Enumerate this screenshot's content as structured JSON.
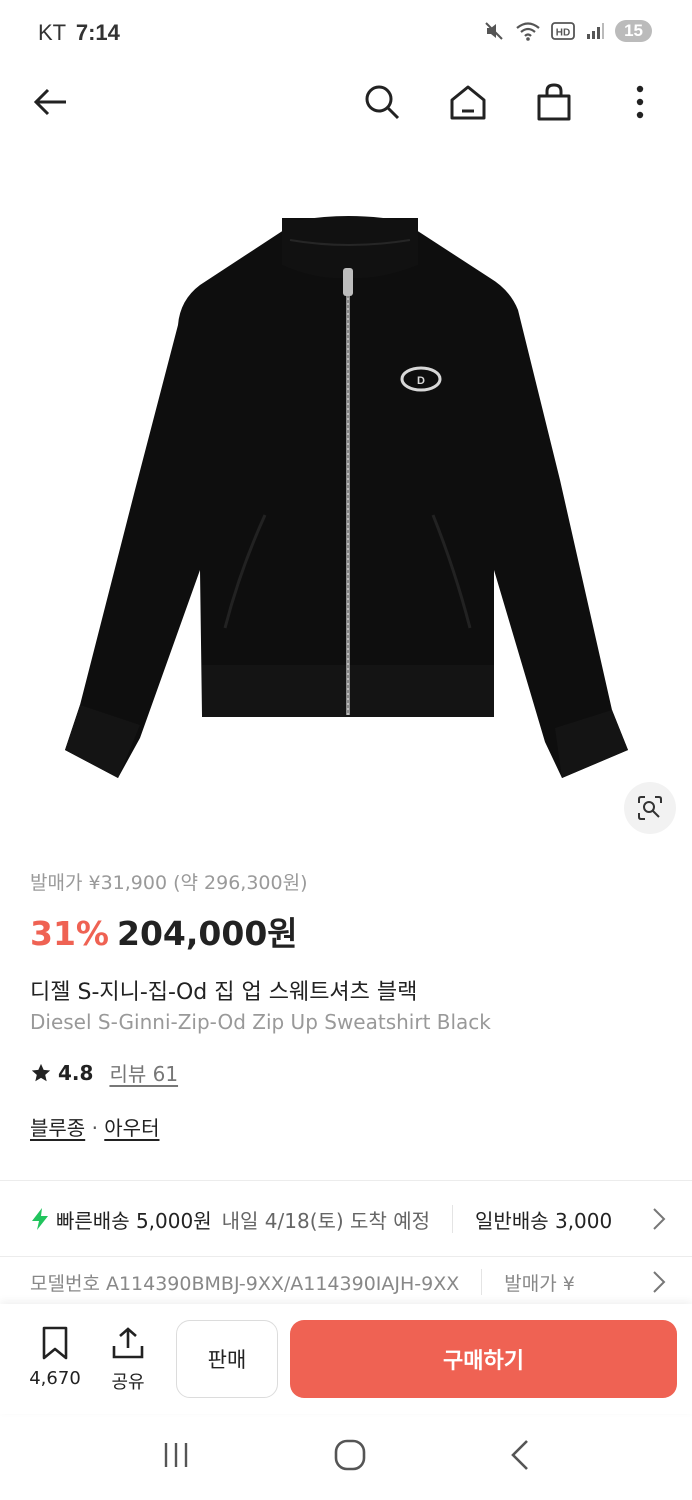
{
  "status_bar": {
    "carrier": "KT",
    "time": "7:14",
    "battery": "15"
  },
  "nav": {
    "icons": [
      "back-arrow-icon",
      "search-icon",
      "home-icon",
      "shopping-bag-icon",
      "more-vertical-icon"
    ]
  },
  "product": {
    "original_price": "발매가 ¥31,900 (약 296,300원)",
    "discount": "31%",
    "price": "204,000원",
    "name_ko": "디젤 S-지니-집-Od 집 업 스웨트셔츠 블랙",
    "name_en": "Diesel S-Ginni-Zip-Od Zip Up Sweatshirt Black",
    "rating": "4.8",
    "review_label": "리뷰 61",
    "category_main": "블루종",
    "category_sep": "·",
    "category_sub": "아우터"
  },
  "shipping": {
    "fast_label": "빠른배송 5,000원",
    "fast_sub": "내일 4/18(토) 도착 예정",
    "normal_label": "일반배송 3,000"
  },
  "model": {
    "model_text": "모델번호 A114390BMBJ-9XX/A114390IAJH-9XX",
    "release_text": "발매가 ¥"
  },
  "bottom_bar": {
    "save_count": "4,670",
    "share_label": "공유",
    "sell_label": "판매",
    "buy_label": "구매하기"
  },
  "colors": {
    "accent": "#ef6253",
    "fast_shipping": "#21c45d",
    "product_body": "#0e0e0e"
  }
}
